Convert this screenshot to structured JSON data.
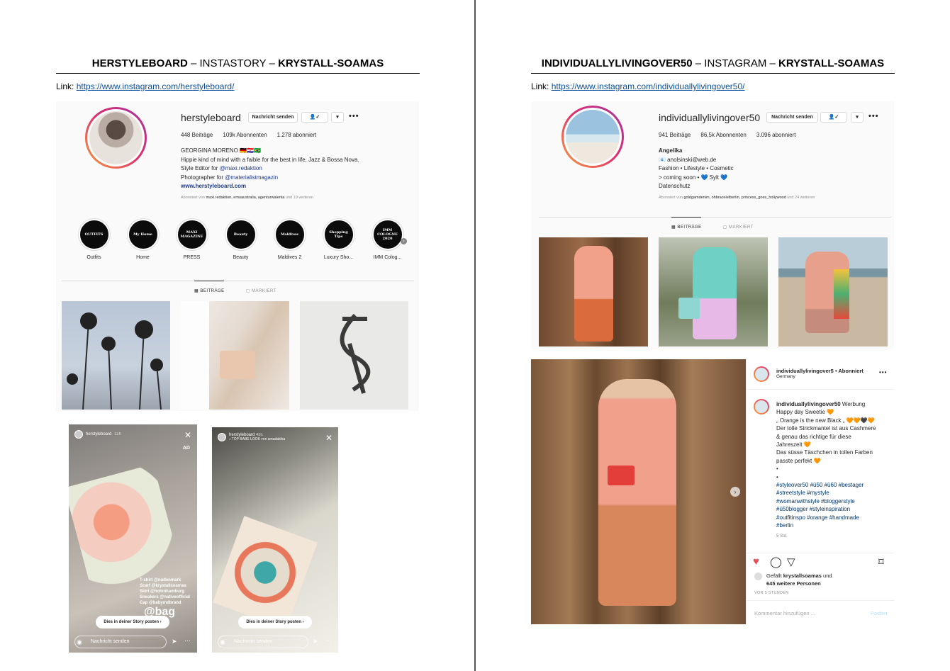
{
  "left": {
    "title": {
      "bold1": "HERSTYLEBOARD",
      "sep1": " – INSTASTORY – ",
      "bold2": "KRYSTALL-SOAMAS"
    },
    "link_label": "Link: ",
    "link_url": "https://www.instagram.com/herstyleboard/",
    "profile": {
      "username": "herstyleboard",
      "message_btn": "Nachricht senden",
      "follow_icon": "👤✓",
      "dropdown_icon": "▾",
      "more_icon": "•••",
      "posts": "448 Beiträge",
      "followers": "109k Abonnenten",
      "following": "1.278 abonniert",
      "name": "GEORGINA MORENO 🇩🇪🇭🇷🇧🇷",
      "bio1": "Hippie kind of mind with a faible for the best in life, Jazz & Bossa Nova.",
      "bio2_pre": "Style Editor for ",
      "bio2_link": "@maxi.redaktion",
      "bio3_pre": "Photographer for ",
      "bio3_link": "@materialistmagazin",
      "website": "www.herstyleboard.com",
      "followed_by_pre": "Abonniert von ",
      "followed_by_names": "maxi.redaktion, emuaustralia, agenturwalenta",
      "followed_by_post": " und 19 weiteren"
    },
    "highlights": [
      {
        "cover": "OUTFITS",
        "label": "Outfits"
      },
      {
        "cover": "My Home",
        "label": "Home"
      },
      {
        "cover": "MAXI MAGAZINE",
        "label": "PRESS"
      },
      {
        "cover": "Beauty",
        "label": "Beauty"
      },
      {
        "cover": "Maldives",
        "label": "Maldives 2"
      },
      {
        "cover": "Shopping Tips",
        "label": "Luxury Sho..."
      },
      {
        "cover": "IMM COLOGNE 2020",
        "label": "IMM Colog..."
      }
    ],
    "tabs": {
      "posts": "▦ BEITRÄGE",
      "tagged": "▢ MARKIERT"
    },
    "stories": [
      {
        "user": "herstyleboard",
        "time": "11h",
        "sub": "",
        "ad": "AD",
        "button": "Dies in deiner Story posten ›",
        "input": "Nachricht senden",
        "caption": "T-shirt @nudenmark\nScarf @krystallsoamas\nSkirt @hohmhamburg\nSneakers @nativeofficial\nCap @babymdbrand",
        "logo": "@bag"
      },
      {
        "user": "herstyleboard",
        "time": "48s",
        "sub": "♪ TOP BABE LOOK von amadaleka",
        "ad": "",
        "button": "Dies in deiner Story posten ›",
        "input": "Nachricht senden",
        "caption": "",
        "logo": ""
      }
    ]
  },
  "right": {
    "title": {
      "bold1": "INDIVIDUALLYLIVINGOVER50",
      "sep1": " – INSTAGRAM – ",
      "bold2": "KRYSTALL-SOAMAS"
    },
    "link_label": "Link: ",
    "link_url": "https://www.instagram.com/individuallylivingover50/",
    "profile": {
      "username": "individuallylivingover50",
      "message_btn": "Nachricht senden",
      "follow_icon": "👤✓",
      "dropdown_icon": "▾",
      "more_icon": "•••",
      "posts": "941 Beiträge",
      "followers": "86,5k Abonnenten",
      "following": "3.096 abonniert",
      "name": "Angelika",
      "bio1": "📧 anolsinski@web.de",
      "bio2": "Fashion • Lifestyle • Cosmetic",
      "bio3": "> coming soon • 💙 Sylt 💙",
      "bio4": "Datenschutz",
      "followed_by_pre": "Abonniert von ",
      "followed_by_names": "goldgamdenim, ohbraceletberlin, princess_goes_hollywood",
      "followed_by_post": " und 24 weiteren"
    },
    "tabs": {
      "posts": "▦ BEITRÄGE",
      "tagged": "▢ MARKIERT"
    },
    "post": {
      "header_user": "individuallylivingover5",
      "header_follow": " • Abonniert",
      "header_location": "Germany",
      "more_icon": "•••",
      "caption_user": "individuallylivingover50",
      "caption_lines": [
        " Werbung",
        "Happy day Sweetie 🧡",
        "„ Orange is the new Black „ 🧡🧡🖤🧡",
        "Der tolle Strickmantel ist aus Cashmere",
        "& genau das richtige für diese",
        "Jahreszeit 🧡",
        "Das süsse Täschchen in tollen Farben",
        "passte perfekt 🧡",
        "•",
        "•"
      ],
      "hashtags": [
        "#styleover50 #ü50 #ü60 #bestager",
        "#streetstyle #mystyle",
        "#womanwithstyle #bloggerstyle",
        "#ü50blogger #styleinspiration",
        "#outfitinspo #orange #handmade",
        "#berlin"
      ],
      "time_ago": "5 Std.",
      "liked_pre": "Gefällt ",
      "liked_user": "krystallsoamas",
      "liked_post": " und",
      "liked_count": "645 weitere Personen",
      "posted": "VOR 5 STUNDEN",
      "comment_placeholder": "Kommentar hinzufügen ...",
      "comment_post": "Posten",
      "icons": {
        "like": "heart-icon",
        "comment": "comment-icon",
        "share": "send-icon",
        "save": "bookmark-icon"
      }
    }
  }
}
